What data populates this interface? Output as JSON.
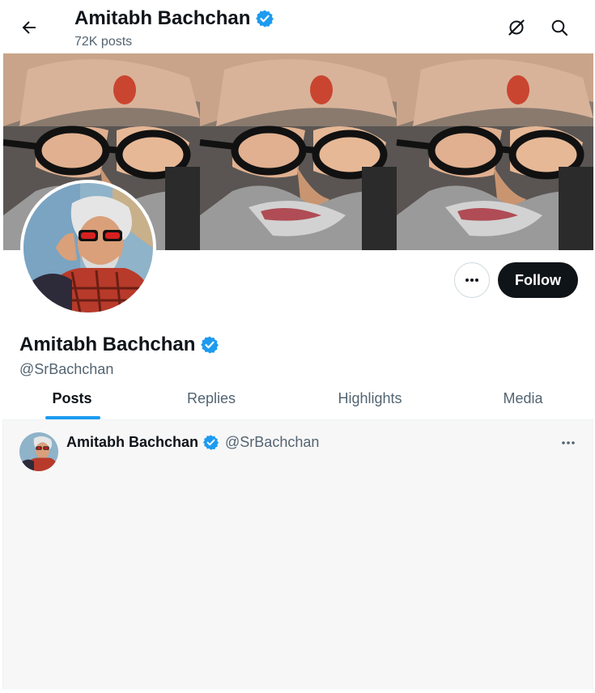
{
  "header": {
    "name": "Amitabh Bachchan",
    "post_count": "72K posts",
    "back_icon": "arrow-left-icon",
    "grok_icon": "grok-icon",
    "search_icon": "search-icon"
  },
  "profile": {
    "name": "Amitabh Bachchan",
    "handle": "@SrBachchan",
    "verified": true,
    "follow_label": "Follow",
    "more_icon": "more-horizontal-icon"
  },
  "tabs": [
    {
      "label": "Posts",
      "active": true
    },
    {
      "label": "Replies",
      "active": false
    },
    {
      "label": "Highlights",
      "active": false
    },
    {
      "label": "Media",
      "active": false
    }
  ],
  "post": {
    "author_name": "Amitabh Bachchan",
    "author_handle": "@SrBachchan",
    "more_icon": "more-horizontal-icon"
  },
  "colors": {
    "accent": "#1d9bf0",
    "text_primary": "#0f1419",
    "text_secondary": "#536471",
    "follow_bg": "#0f1419",
    "feed_bg": "#f7f7f7"
  }
}
